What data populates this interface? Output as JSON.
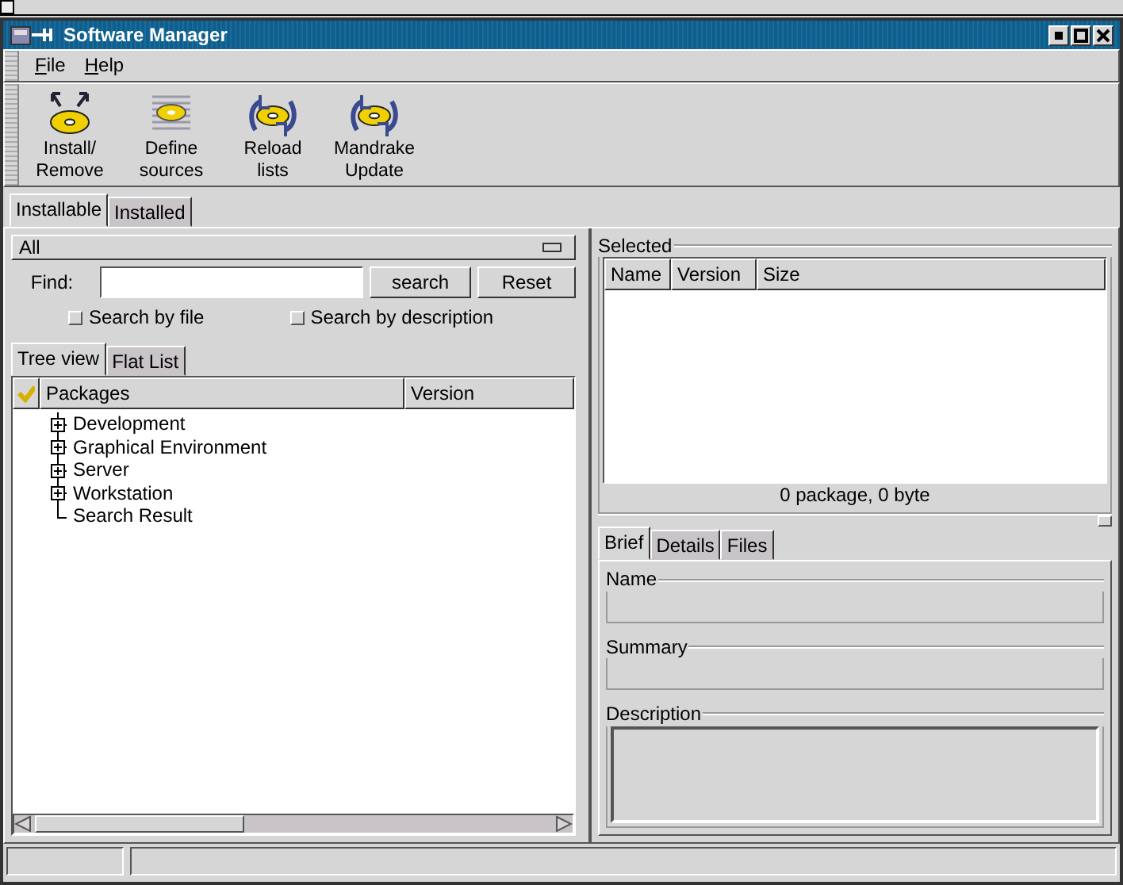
{
  "window": {
    "title": "Software Manager"
  },
  "menu": [
    {
      "label": "File"
    },
    {
      "label": "Help"
    }
  ],
  "toolbar": [
    {
      "kind": "install",
      "lines": [
        "Install/",
        "Remove"
      ]
    },
    {
      "kind": "sources",
      "lines": [
        "Define",
        "sources"
      ]
    },
    {
      "kind": "reload",
      "lines": [
        "Reload",
        "lists"
      ]
    },
    {
      "kind": "update",
      "lines": [
        "Mandrake",
        "Update"
      ]
    }
  ],
  "main_tabs": [
    {
      "label": "Installable",
      "selected": true
    },
    {
      "label": "Installed",
      "selected": false
    }
  ],
  "category": {
    "value": "All"
  },
  "find": {
    "label": "Find:",
    "buttons": [
      "search",
      "Reset"
    ]
  },
  "search_options": [
    {
      "label": "Search by file",
      "checked": false
    },
    {
      "label": "Search by description",
      "checked": false
    }
  ],
  "view_tabs": [
    {
      "label": "Tree view",
      "selected": true
    },
    {
      "label": "Flat List",
      "selected": false
    }
  ],
  "tree": {
    "columns": [
      "Packages",
      "Version"
    ],
    "items": [
      {
        "label": "Development",
        "kind": "group"
      },
      {
        "label": "Graphical Environment",
        "kind": "group"
      },
      {
        "label": "Server",
        "kind": "group"
      },
      {
        "label": "Workstation",
        "kind": "group"
      },
      {
        "label": "Search Result",
        "kind": "leaf"
      }
    ]
  },
  "selected": {
    "title": "Selected",
    "columns": [
      "Name",
      "Version",
      "Size"
    ],
    "status": "0 package, 0 byte"
  },
  "info_tabs": [
    {
      "label": "Brief",
      "selected": true
    },
    {
      "label": "Details",
      "selected": false
    },
    {
      "label": "Files",
      "selected": false
    }
  ],
  "info_fields": [
    {
      "label": "Name",
      "kind": "line"
    },
    {
      "label": "Summary",
      "kind": "line"
    },
    {
      "label": "Description",
      "kind": "area"
    }
  ]
}
